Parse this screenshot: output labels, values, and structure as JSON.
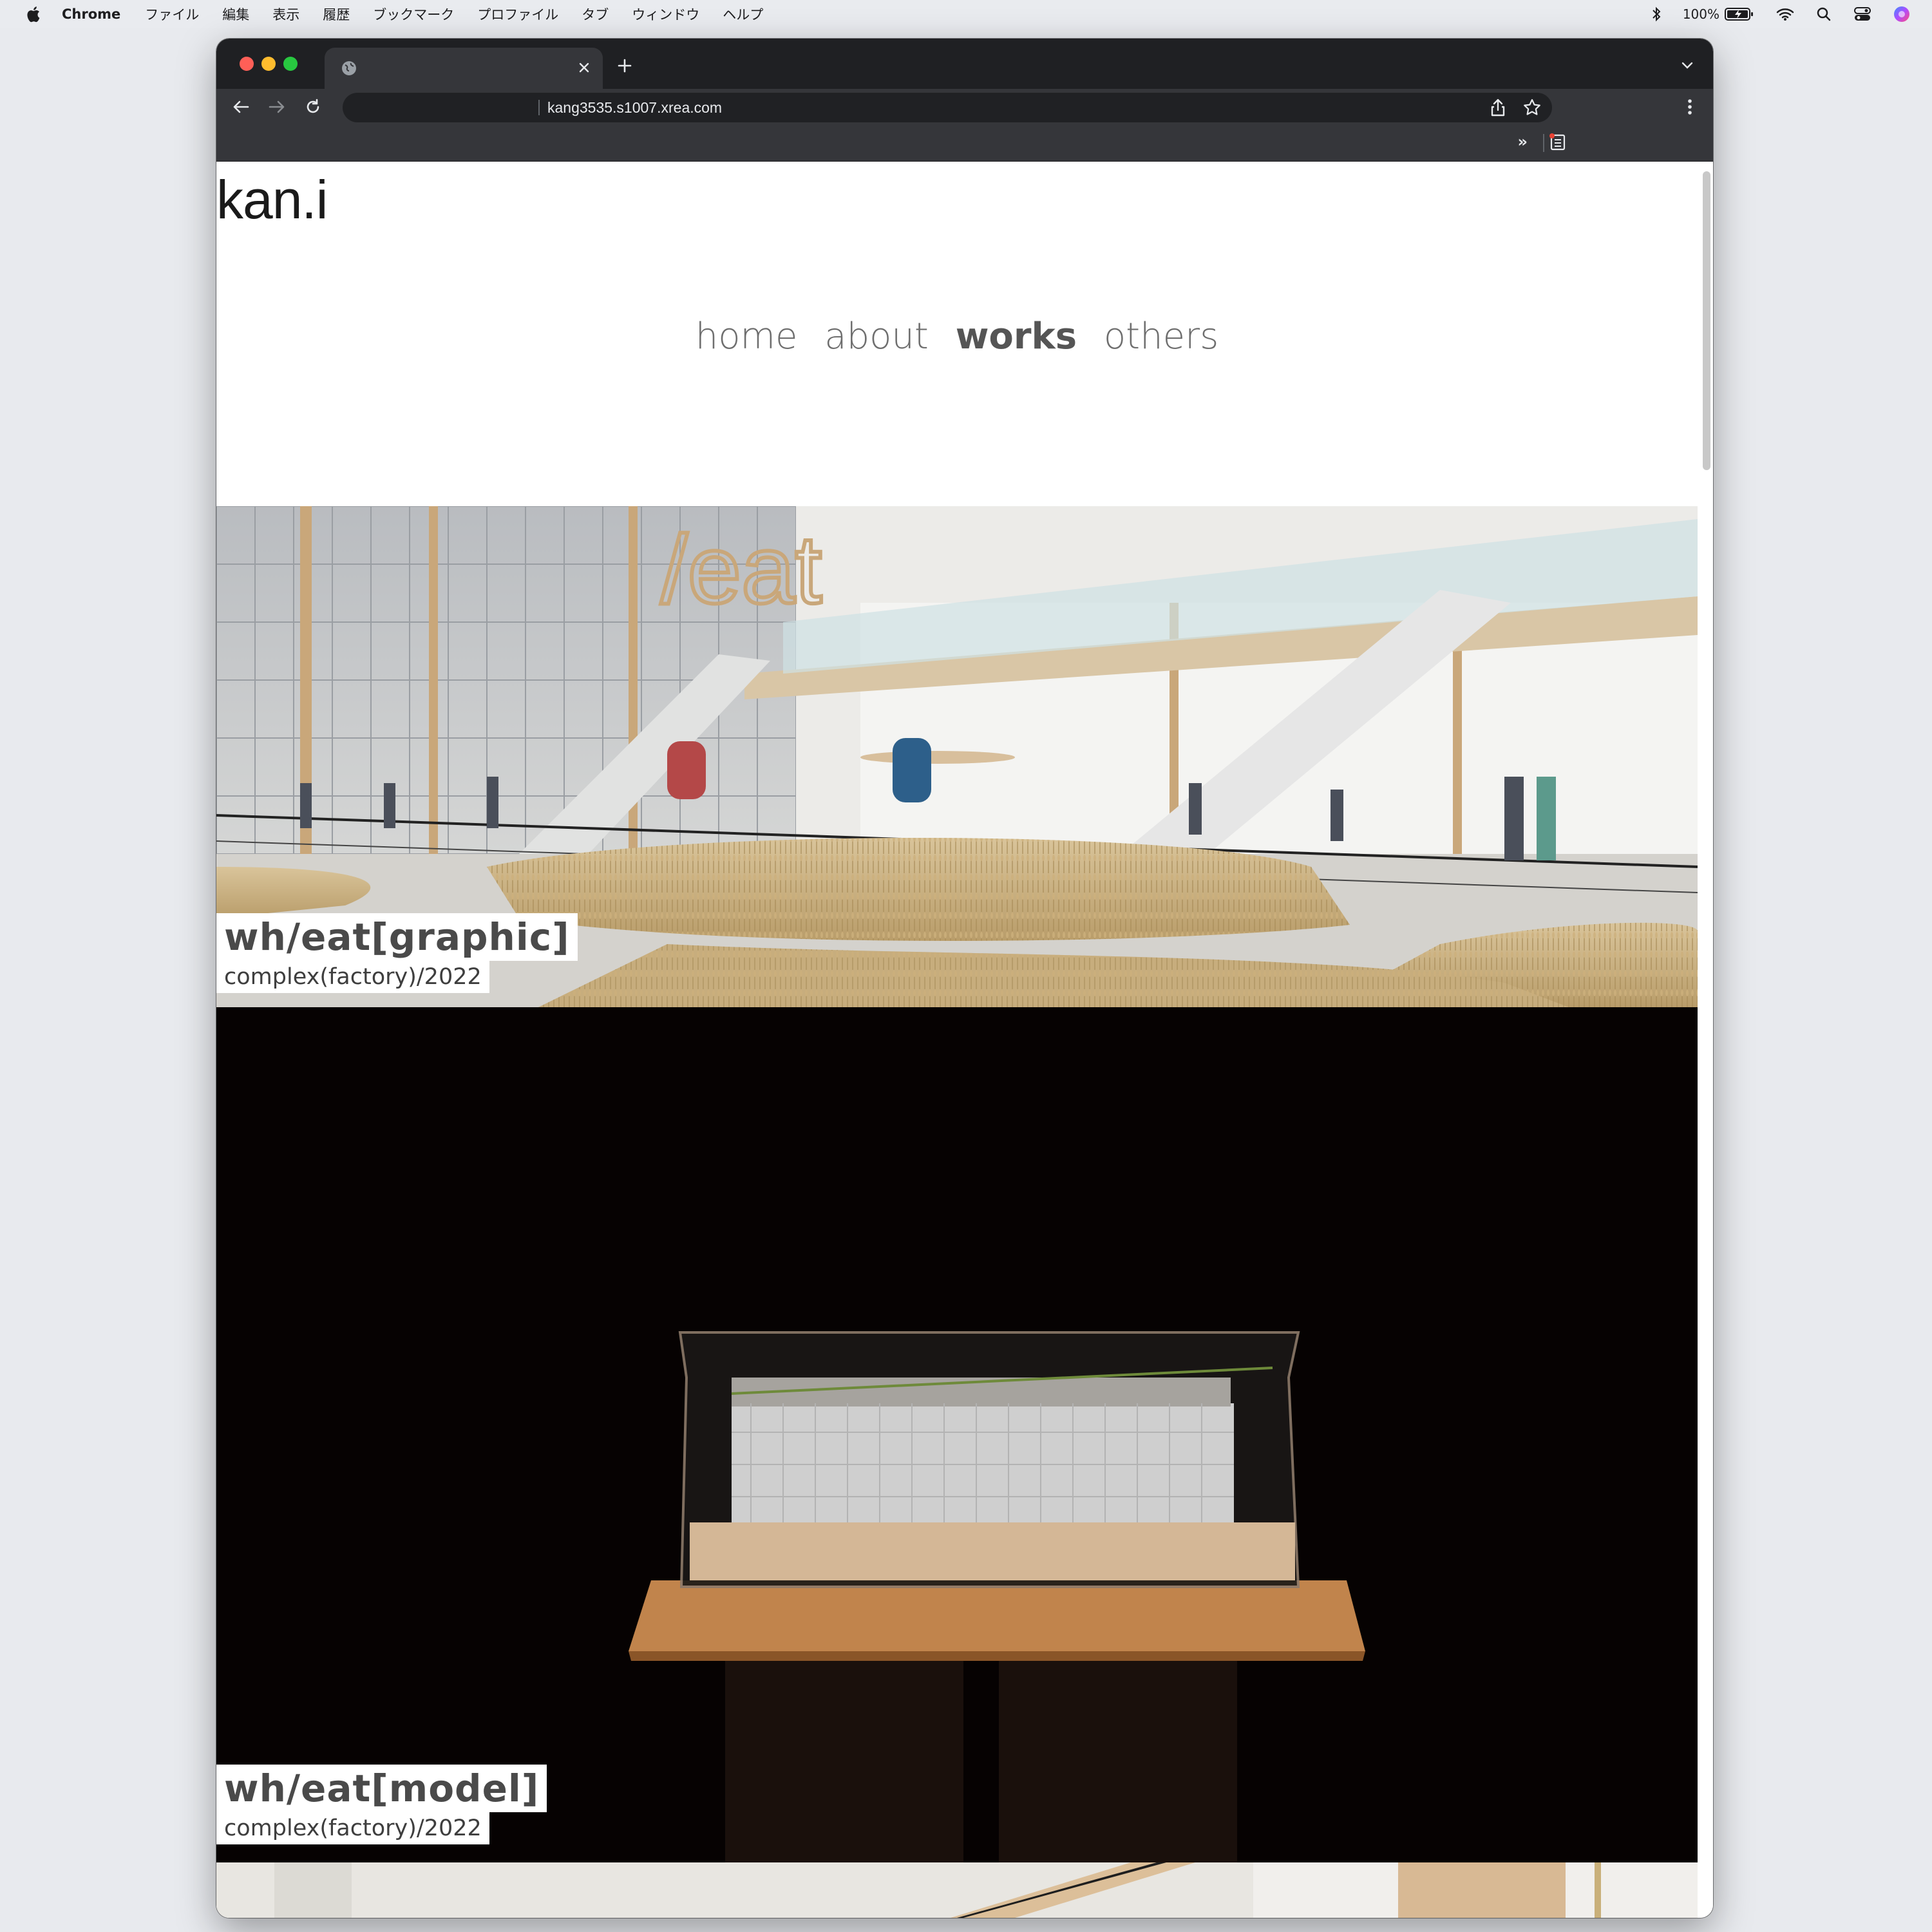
{
  "menubar": {
    "app_name": "Chrome",
    "menus": [
      "ファイル",
      "編集",
      "表示",
      "履歴",
      "ブックマーク",
      "プロファイル",
      "タブ",
      "ウィンドウ",
      "ヘルプ"
    ],
    "battery": "100%"
  },
  "browser": {
    "url": "kang3535.s1007.xrea.com",
    "bookmarks_overflow": "»"
  },
  "site": {
    "logo": "kan.i",
    "nav": [
      {
        "label": "home",
        "active": false
      },
      {
        "label": "about",
        "active": false
      },
      {
        "label": "works",
        "active": true
      },
      {
        "label": "others",
        "active": false
      }
    ]
  },
  "works": [
    {
      "title": "wh/eat[graphic]",
      "subtitle": "complex(factory)/2022",
      "sign_text": "/eat"
    },
    {
      "title": "wh/eat[model]",
      "subtitle": "complex(factory)/2022"
    }
  ]
}
